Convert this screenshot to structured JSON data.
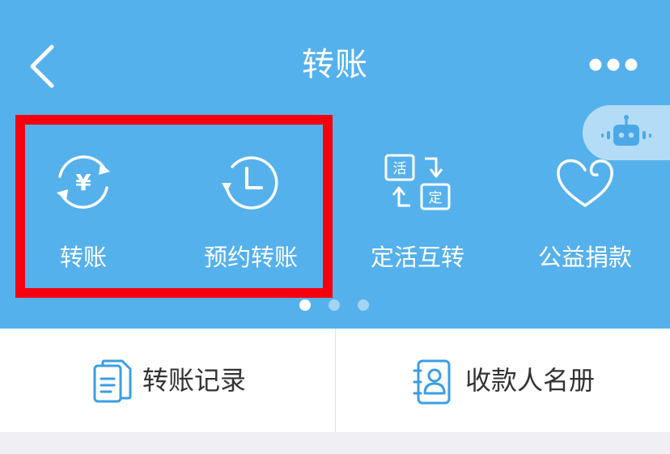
{
  "header": {
    "title": "转账",
    "back_icon": "chevron-left-icon",
    "more_icon": "more-dots-icon"
  },
  "assistant": {
    "icon": "robot-icon"
  },
  "functions": [
    {
      "label": "转账",
      "icon": "yuan-transfer-icon"
    },
    {
      "label": "预约转账",
      "icon": "clock-schedule-icon"
    },
    {
      "label": "定活互转",
      "icon": "current-fixed-swap-icon",
      "icon_text_top": "活",
      "icon_text_bottom": "定"
    },
    {
      "label": "公益捐款",
      "icon": "heart-icon"
    }
  ],
  "pager": {
    "count": 3,
    "active_index": 0
  },
  "bottom_links": [
    {
      "label": "转账记录",
      "icon": "document-records-icon"
    },
    {
      "label": "收款人名册",
      "icon": "contact-book-icon"
    }
  ],
  "colors": {
    "primary_blue": "#55b1ec",
    "highlight_red": "#f4000f",
    "text_dark": "#333333",
    "icon_blue": "#3a9ee4",
    "dot_active": "#ffffff",
    "dot_inactive": "#a4d3f4"
  }
}
